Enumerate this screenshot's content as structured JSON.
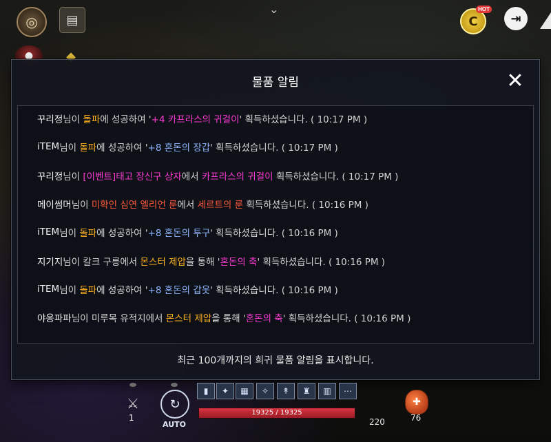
{
  "hud": {
    "top_chevron": "⌄",
    "hot_badge": "HOT",
    "coin_icon": "C",
    "auto_label": "AUTO",
    "weapon_count": "1",
    "hp": {
      "text": "19325 / 19325",
      "ratio": 1.0,
      "color": "#d6343f"
    },
    "level_value": "220",
    "potion_count": "76"
  },
  "modal": {
    "title": "물품 알림",
    "close_icon": "✕",
    "footer": "최근 100개까지의 희귀 물품 알림을 표시합니다.",
    "colors": {
      "white": "#f2f2f2",
      "orange": "#ffb020",
      "pink": "#ff3bd6",
      "blue": "#8fb6ff",
      "red": "#ff5a3a"
    },
    "entries": [
      {
        "segments": [
          {
            "text": "꾸리정",
            "color": "white"
          },
          {
            "text": "님이 ",
            "color": "gray"
          },
          {
            "text": "돌파",
            "color": "orange"
          },
          {
            "text": "에 성공하여 '",
            "color": "gray"
          },
          {
            "text": "+4 카프라스의 귀걸이",
            "color": "pink"
          },
          {
            "text": "' 획득하셨습니다. ( 10:17 PM )",
            "color": "gray"
          }
        ]
      },
      {
        "segments": [
          {
            "text": "iTEM",
            "color": "white"
          },
          {
            "text": "님이 ",
            "color": "gray"
          },
          {
            "text": "돌파",
            "color": "orange"
          },
          {
            "text": "에 성공하여 '",
            "color": "gray"
          },
          {
            "text": "+8 혼돈의 장갑",
            "color": "blue"
          },
          {
            "text": "' 획득하셨습니다. ( 10:17 PM )",
            "color": "gray"
          }
        ]
      },
      {
        "segments": [
          {
            "text": "꾸리정",
            "color": "white"
          },
          {
            "text": "님이 ",
            "color": "gray"
          },
          {
            "text": "[이벤트]태고 장신구 상자",
            "color": "pink"
          },
          {
            "text": "에서 ",
            "color": "gray"
          },
          {
            "text": "카프라스의 귀걸이",
            "color": "pink"
          },
          {
            "text": " 획득하셨습니다. ( 10:17 PM )",
            "color": "gray"
          }
        ]
      },
      {
        "segments": [
          {
            "text": "메이썸머",
            "color": "white"
          },
          {
            "text": "님이 ",
            "color": "gray"
          },
          {
            "text": "미확인 심연 엘리언 룬",
            "color": "red"
          },
          {
            "text": "에서 ",
            "color": "gray"
          },
          {
            "text": "세르트의 룬",
            "color": "red"
          },
          {
            "text": " 획득하셨습니다. ( 10:16 PM )",
            "color": "gray"
          }
        ]
      },
      {
        "segments": [
          {
            "text": "iTEM",
            "color": "white"
          },
          {
            "text": "님이 ",
            "color": "gray"
          },
          {
            "text": "돌파",
            "color": "orange"
          },
          {
            "text": "에 성공하여 '",
            "color": "gray"
          },
          {
            "text": "+8 혼돈의 투구",
            "color": "blue"
          },
          {
            "text": "' 획득하셨습니다. ( 10:16 PM )",
            "color": "gray"
          }
        ]
      },
      {
        "segments": [
          {
            "text": "지기지",
            "color": "white"
          },
          {
            "text": "님이 칼크 구릉에서 ",
            "color": "gray"
          },
          {
            "text": "몬스터 제압",
            "color": "orange"
          },
          {
            "text": "을 통해 '",
            "color": "gray"
          },
          {
            "text": "혼돈의 축",
            "color": "pink"
          },
          {
            "text": "' 획득하셨습니다. ( 10:16 PM )",
            "color": "gray"
          }
        ]
      },
      {
        "segments": [
          {
            "text": "iTEM",
            "color": "white"
          },
          {
            "text": "님이 ",
            "color": "gray"
          },
          {
            "text": "돌파",
            "color": "orange"
          },
          {
            "text": "에 성공하여 '",
            "color": "gray"
          },
          {
            "text": "+8 혼돈의 갑옷",
            "color": "blue"
          },
          {
            "text": "' 획득하셨습니다. ( 10:16 PM )",
            "color": "gray"
          }
        ]
      },
      {
        "segments": [
          {
            "text": "야옹파파",
            "color": "white"
          },
          {
            "text": "님이 미루목 유적지에서 ",
            "color": "gray"
          },
          {
            "text": "몬스터 제압",
            "color": "orange"
          },
          {
            "text": "을 통해 '",
            "color": "gray"
          },
          {
            "text": "혼돈의 축",
            "color": "pink"
          },
          {
            "text": "' 획득하셨습니다. ( 10:16 PM )",
            "color": "gray"
          }
        ]
      }
    ]
  }
}
